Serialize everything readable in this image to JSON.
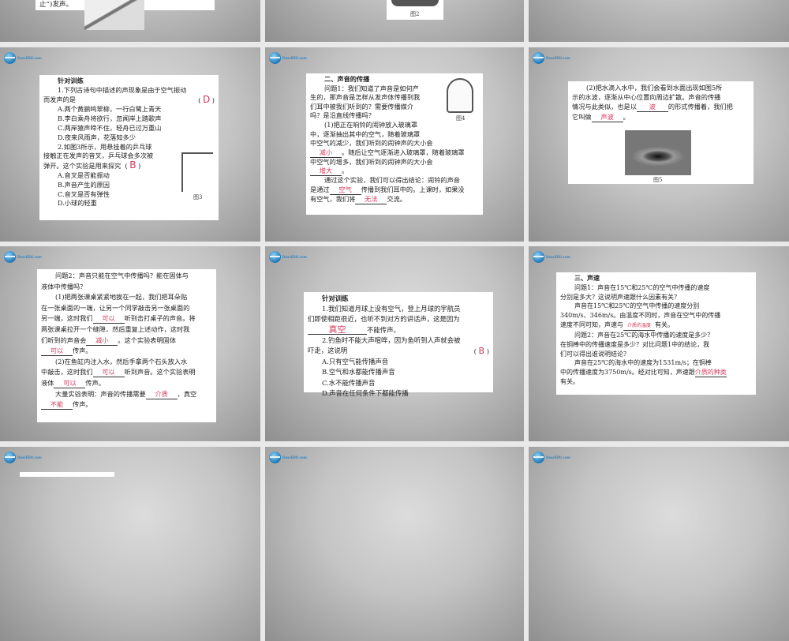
{
  "slides": [
    {
      "id": "r0c1",
      "text": "止”)发声。"
    },
    {
      "id": "r0c2",
      "figure": "图2"
    },
    {
      "id": "r1c1",
      "title": "针对训练",
      "q1": "1.下列古诗句中描述的声现象是由于空气振动",
      "q1b": "而发声的是",
      "q1_answer": "D",
      "q1_options": [
        "A.两个黄鹂鸣翠柳，一行白鹭上青天",
        "B.李白乘舟将欲行，忽闻岸上踏歌声",
        "C.两岸猿声啼不住，轻舟已过万重山",
        "D.夜来风雨声，花落知多少"
      ],
      "q2": [
        "2.如图3所示，用悬挂着的乒乓球",
        "接触正在发声的音叉，乒乓球会多次被",
        "弹开。这个实验是用来探究"
      ],
      "q2_answer": "B",
      "q2_options": [
        "A.音叉是否能振动",
        "B.声音产生的原因",
        "C.音叉是否有弹性",
        "D.小球的轻重"
      ],
      "figure": "图3"
    },
    {
      "id": "r1c2",
      "title": "二、声音的传播",
      "lines": [
        "问题1：我们知道了声音是如何产",
        "生的，那声音是怎样从发声体传播到我",
        "们耳中被我们听到的？需要传播媒介",
        "吗？是沿直线传播吗？",
        "(1)把正在响铃的闹钟放入玻璃罩",
        "中，逐渐抽出其中的空气，随着玻璃罩",
        "中空气的减少，我们听到的闹钟声的大小会"
      ],
      "a1": "减小",
      "l2": "。随后让空气逐渐进入玻璃罩，随着玻璃罩",
      "l3": "中空气的增多，我们听到的闹钟声的大小会",
      "a2": "增大",
      "l4": "。",
      "l5": "通过这个实验，我们可以得出结论：闹铃的声音",
      "l6a": "是通过",
      "a3": "空气",
      "l6b": "传播到我们耳中的。上课时，如果没",
      "l7a": "有空气，我们将",
      "a4": "无法",
      "l7b": "交流。",
      "figure": "图4"
    },
    {
      "id": "r1c3",
      "l1": "(2)把水滴入水中，我们会看到水面出现如图5所",
      "l2": "示的水波，逐渐从中心位置向周边扩散。声音的传播",
      "l3a": "情况与此类似，也是以",
      "a1": "波",
      "l3b": "的形式传播着，我们把",
      "l4a": "它叫做",
      "a2": "声波",
      "l4b": "。",
      "figure": "图5"
    },
    {
      "id": "r2c1",
      "l1": "问题2：声音只能在空气中传播吗？能在固体与",
      "l2": "液体中传播吗？",
      "l3": "(1)把两张课桌紧紧地挨在一起，我们把耳朵贴",
      "l4": "在一张桌面的一端，让另一个同学敲击另一张桌面的",
      "l5a": "另一端，这时我们",
      "a1": "可以",
      "l5b": "听到击打桌子的声音。将",
      "l6": "两张课桌拉开一个缝隙，然后重复上述动作，这时我",
      "l7a": "们听到的声音会",
      "a2": "减小",
      "l7b": "。这个实验表明固体",
      "a3": "可以",
      "l8b": "传声。",
      "l9": "(2)在鱼缸内注入水，然后手拿两个石头放入水",
      "l10a": "中敲击，这时我们",
      "a4": "可以",
      "l10b": "听到声音。这个实验表明",
      "l11a": "液体",
      "a5": "可以",
      "l11b": "传声。",
      "l12a": "大量实验表明：声音的传播需要",
      "a6": "介质",
      "l12b": "，真空",
      "a7": "不能",
      "l13b": "传声。"
    },
    {
      "id": "r2c2",
      "title": "针对训练",
      "l1": "1.我们知道月球上没有空气，登上月球的宇航员",
      "l2": "们即使相距很近，也听不到对方的讲话声，这是因为",
      "a1": "真空",
      "l3b": "不能传声。",
      "l4": "2.钓鱼时不能大声喧哗，因为鱼听到人声就会被",
      "l5": "吓走，这说明",
      "a2": "B",
      "options": [
        "A.只有空气能传播声音",
        "B.空气和水都能传播声音",
        "C.水不能传播声音",
        "D.声音在任何条件下都能传播"
      ]
    },
    {
      "id": "r2c3",
      "title": "三、声速",
      "l1": "问题1：声音在15℃和25℃的空气中传播的速度",
      "l2": "分别是多大？这说明声速跟什么因素有关？",
      "l3": "声音在15℃和25℃的空气中传播的速度分别",
      "l4": "340m/s、346m/s。由温度不同时，声音在空气中的传播",
      "l5a": "速度不同可知，声速与",
      "a1": "介质的温度",
      "l5b": "有关。",
      "l6": "问题2：声音在25℃的海水中传播的速度是多少？",
      "l7": "在铜棒中的传播速度是多少？对比问题1中的结论，我",
      "l8": "们可以得出谁说明结论？",
      "l9": "声音在25℃的海水中的速度为1531m/s；在铜棒",
      "l10a": "中的传播速度为3750m/s。经对比可知，声速跟",
      "a2": "介质的种类",
      "l11": "有关。"
    }
  ],
  "logo": {
    "text": "DearEDU.com"
  }
}
